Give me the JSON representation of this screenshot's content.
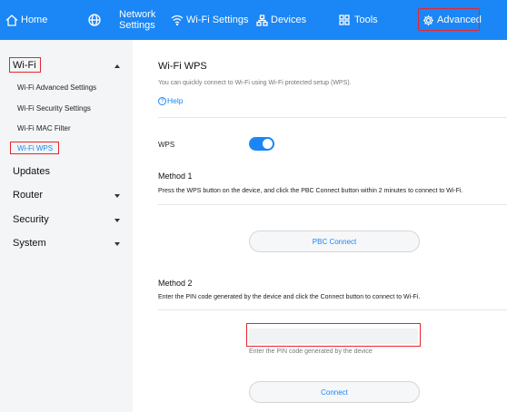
{
  "topnav": {
    "home": "Home",
    "network_line1": "Network",
    "network_line2": "Settings",
    "wifi_settings": "Wi-Fi Settings",
    "devices": "Devices",
    "tools": "Tools",
    "advanced": "Advanced"
  },
  "sidebar": {
    "wifi": "Wi-Fi",
    "wifi_sub": [
      "Wi-Fi Advanced Settings",
      "Wi-Fi Security Settings",
      "Wi-Fi MAC Filter",
      "Wi-Fi WPS"
    ],
    "updates": "Updates",
    "router": "Router",
    "security": "Security",
    "system": "System"
  },
  "content": {
    "title": "Wi-Fi WPS",
    "description": "You can quickly connect to Wi-Fi using Wi-Fi protected setup (WPS).",
    "help": "Help",
    "wps_label": "WPS",
    "wps_enabled": true,
    "method1_title": "Method 1",
    "method1_desc": "Press the WPS button on the device, and click the PBC Connect button within 2 minutes to connect to Wi-Fi.",
    "pbc_button": "PBC Connect",
    "method2_title": "Method 2",
    "method2_desc": "Enter the PIN code generated by the device and click the Connect button to connect to Wi-Fi.",
    "pin_value": "",
    "pin_hint": "Enter the PIN code generated by the device",
    "connect_button": "Connect"
  },
  "colors": {
    "topbar": "#1b86f5",
    "highlight_border": "#e8262d",
    "accent": "#1b86f5",
    "sidebar_bg": "#f4f5f7"
  }
}
